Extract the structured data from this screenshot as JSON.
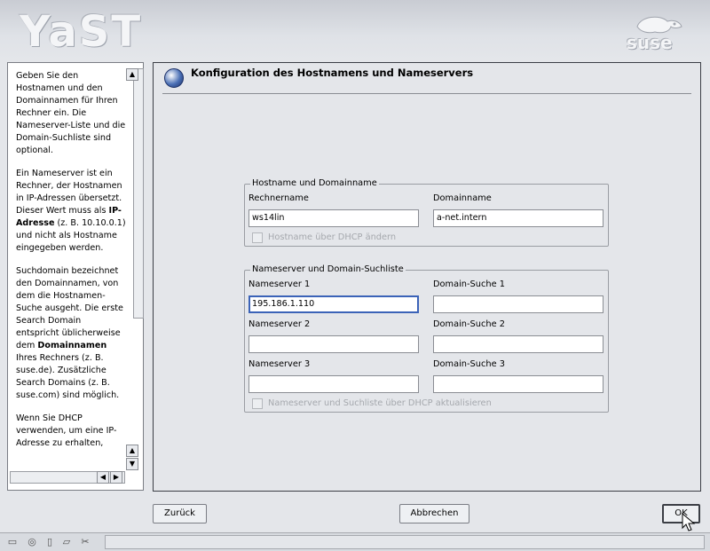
{
  "header": {
    "app_logo": "YaST",
    "vendor_logo": "suse"
  },
  "help": {
    "paragraphs": [
      "Geben Sie den Hostnamen und den Domainnamen für Ihren Rechner ein. Die Nameserver-Liste und die Domain-Suchliste sind optional.",
      "Ein Nameserver ist ein Rechner, der Hostnamen in IP-Adressen übersetzt. Dieser Wert muss als IP-Adresse (z. B. 10.10.0.1) und nicht als Hostname eingegeben werden.",
      "Suchdomain bezeichnet den Domainnamen, von dem die Hostnamen-Suche ausgeht. Die erste Search Domain entspricht üblicherweise dem Domainnamen Ihres Rechners (z. B. suse.de). Zusätzliche Search Domains (z. B. suse.com) sind möglich.",
      "Wenn Sie DHCP verwenden, um eine IP-Adresse zu erhalten,"
    ],
    "bold_terms": [
      "IP-Adresse",
      "Domainnamen"
    ]
  },
  "dialog": {
    "title": "Konfiguration des Hostnamens und Nameservers",
    "host_group": {
      "legend": "Hostname und Domainname",
      "hostname_label": "Rechnername",
      "hostname_value": "ws14lin",
      "domain_label": "Domainname",
      "domain_value": "a-net.intern",
      "dhcp_checkbox_label": "Hostname über DHCP ändern",
      "dhcp_checked": false
    },
    "ns_group": {
      "legend": "Nameserver und Domain-Suchliste",
      "ns1_label": "Nameserver 1",
      "ns1_value": "195.186.1.110",
      "ns2_label": "Nameserver 2",
      "ns2_value": "",
      "ns3_label": "Nameserver 3",
      "ns3_value": "",
      "search1_label": "Domain-Suche 1",
      "search1_value": "",
      "search2_label": "Domain-Suche 2",
      "search2_value": "",
      "search3_label": "Domain-Suche 3",
      "search3_value": "",
      "dhcp_checkbox_label": "Nameserver und Suchliste über DHCP aktualisieren",
      "dhcp_checked": false
    }
  },
  "buttons": {
    "back": "Zurück",
    "abort": "Abbrechen",
    "ok": "OK"
  },
  "taskbar": {
    "icons": [
      "drive-icon",
      "circle-icon",
      "document-icon",
      "folder-icon",
      "tools-icon"
    ]
  }
}
